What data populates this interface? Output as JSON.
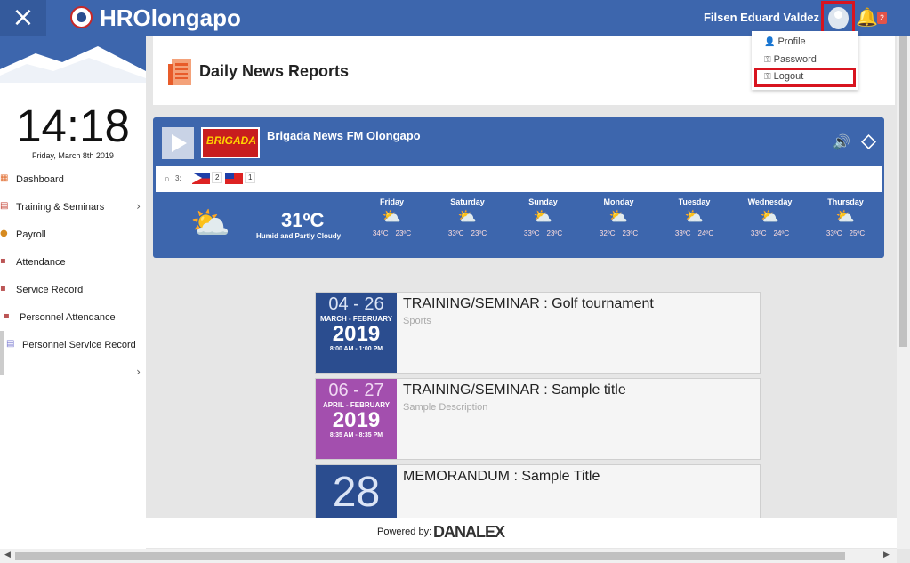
{
  "topbar": {
    "close_icon": "×",
    "app_name": "HROlongapo",
    "user_name": "Filsen Eduard Valdez",
    "bell_icon": "🔔",
    "notification_count": "2"
  },
  "dropdown": {
    "profile": "Profile",
    "password": "Password",
    "logout": "Logout"
  },
  "sidebar": {
    "time": "14:18",
    "date": "Friday, March 8th 2019",
    "items": [
      {
        "label": "Dashboard",
        "icon": "dashboard-icon"
      },
      {
        "label": "Training & Seminars",
        "icon": "calendar-icon"
      },
      {
        "label": "Payroll",
        "icon": "payroll-icon"
      },
      {
        "label": "Attendance",
        "icon": "attendance-icon"
      },
      {
        "label": "Service Record",
        "icon": "service-record-icon"
      },
      {
        "label": "Personnel Attendance",
        "icon": "personnel-attendance-icon"
      },
      {
        "label": "Personnel Service Record",
        "icon": "personnel-service-icon"
      }
    ]
  },
  "header": {
    "title": "Daily News Reports"
  },
  "radio": {
    "logo_text": "BRIGADA",
    "station": "Brigada News FM Olongapo",
    "listeners_label": "3:",
    "ph_count": "2",
    "tw_count": "1"
  },
  "weather": {
    "current_temp": "31ºC",
    "current_desc": "Humid and Partly Cloudy",
    "days": [
      {
        "name": "Friday",
        "high": "34ºC",
        "low": "23ºC"
      },
      {
        "name": "Saturday",
        "high": "33ºC",
        "low": "23ºC"
      },
      {
        "name": "Sunday",
        "high": "33ºC",
        "low": "23ºC"
      },
      {
        "name": "Monday",
        "high": "32ºC",
        "low": "23ºC"
      },
      {
        "name": "Tuesday",
        "high": "33ºC",
        "low": "24ºC"
      },
      {
        "name": "Wednesday",
        "high": "33ºC",
        "low": "24ºC"
      },
      {
        "name": "Thursday",
        "high": "33ºC",
        "low": "25ºC"
      }
    ]
  },
  "events": [
    {
      "range": "04 - 26",
      "months": "MARCH - FEBRUARY",
      "year": "2019",
      "time": "8:00 AM - 1:00 PM",
      "title": "TRAINING/SEMINAR : Golf tournament",
      "desc": "Sports",
      "color": "#2b4d8f"
    },
    {
      "range": "06 - 27",
      "months": "APRIL - FEBRUARY",
      "year": "2019",
      "time": "8:35 AM - 8:35 PM",
      "title": "TRAINING/SEMINAR : Sample title",
      "desc": "Sample Description",
      "color": "#a34fae"
    },
    {
      "range": "28",
      "months": "",
      "year": "",
      "time": "",
      "title": "MEMORANDUM : Sample Title",
      "desc": "",
      "color": "#2b4d8f"
    }
  ],
  "footer": {
    "powered_by": "Powered by:",
    "brand": "DANALEX"
  },
  "colors": {
    "primary": "#3d66ad",
    "highlight": "#d8141f"
  }
}
